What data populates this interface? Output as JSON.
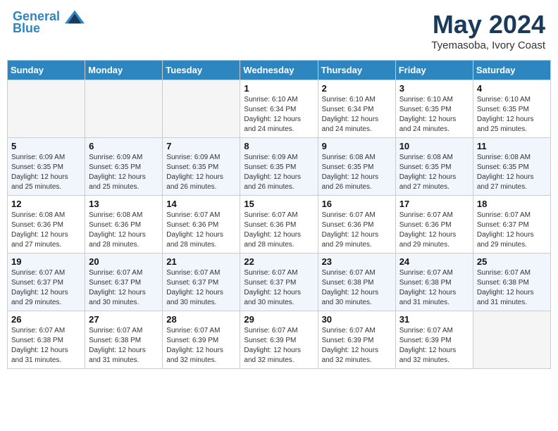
{
  "header": {
    "logo_line1": "General",
    "logo_line2": "Blue",
    "month": "May 2024",
    "location": "Tyemasoba, Ivory Coast"
  },
  "weekdays": [
    "Sunday",
    "Monday",
    "Tuesday",
    "Wednesday",
    "Thursday",
    "Friday",
    "Saturday"
  ],
  "weeks": [
    [
      {
        "day": "",
        "info": ""
      },
      {
        "day": "",
        "info": ""
      },
      {
        "day": "",
        "info": ""
      },
      {
        "day": "1",
        "info": "Sunrise: 6:10 AM\nSunset: 6:34 PM\nDaylight: 12 hours\nand 24 minutes."
      },
      {
        "day": "2",
        "info": "Sunrise: 6:10 AM\nSunset: 6:34 PM\nDaylight: 12 hours\nand 24 minutes."
      },
      {
        "day": "3",
        "info": "Sunrise: 6:10 AM\nSunset: 6:35 PM\nDaylight: 12 hours\nand 24 minutes."
      },
      {
        "day": "4",
        "info": "Sunrise: 6:10 AM\nSunset: 6:35 PM\nDaylight: 12 hours\nand 25 minutes."
      }
    ],
    [
      {
        "day": "5",
        "info": "Sunrise: 6:09 AM\nSunset: 6:35 PM\nDaylight: 12 hours\nand 25 minutes."
      },
      {
        "day": "6",
        "info": "Sunrise: 6:09 AM\nSunset: 6:35 PM\nDaylight: 12 hours\nand 25 minutes."
      },
      {
        "day": "7",
        "info": "Sunrise: 6:09 AM\nSunset: 6:35 PM\nDaylight: 12 hours\nand 26 minutes."
      },
      {
        "day": "8",
        "info": "Sunrise: 6:09 AM\nSunset: 6:35 PM\nDaylight: 12 hours\nand 26 minutes."
      },
      {
        "day": "9",
        "info": "Sunrise: 6:08 AM\nSunset: 6:35 PM\nDaylight: 12 hours\nand 26 minutes."
      },
      {
        "day": "10",
        "info": "Sunrise: 6:08 AM\nSunset: 6:35 PM\nDaylight: 12 hours\nand 27 minutes."
      },
      {
        "day": "11",
        "info": "Sunrise: 6:08 AM\nSunset: 6:35 PM\nDaylight: 12 hours\nand 27 minutes."
      }
    ],
    [
      {
        "day": "12",
        "info": "Sunrise: 6:08 AM\nSunset: 6:36 PM\nDaylight: 12 hours\nand 27 minutes."
      },
      {
        "day": "13",
        "info": "Sunrise: 6:08 AM\nSunset: 6:36 PM\nDaylight: 12 hours\nand 28 minutes."
      },
      {
        "day": "14",
        "info": "Sunrise: 6:07 AM\nSunset: 6:36 PM\nDaylight: 12 hours\nand 28 minutes."
      },
      {
        "day": "15",
        "info": "Sunrise: 6:07 AM\nSunset: 6:36 PM\nDaylight: 12 hours\nand 28 minutes."
      },
      {
        "day": "16",
        "info": "Sunrise: 6:07 AM\nSunset: 6:36 PM\nDaylight: 12 hours\nand 29 minutes."
      },
      {
        "day": "17",
        "info": "Sunrise: 6:07 AM\nSunset: 6:36 PM\nDaylight: 12 hours\nand 29 minutes."
      },
      {
        "day": "18",
        "info": "Sunrise: 6:07 AM\nSunset: 6:37 PM\nDaylight: 12 hours\nand 29 minutes."
      }
    ],
    [
      {
        "day": "19",
        "info": "Sunrise: 6:07 AM\nSunset: 6:37 PM\nDaylight: 12 hours\nand 29 minutes."
      },
      {
        "day": "20",
        "info": "Sunrise: 6:07 AM\nSunset: 6:37 PM\nDaylight: 12 hours\nand 30 minutes."
      },
      {
        "day": "21",
        "info": "Sunrise: 6:07 AM\nSunset: 6:37 PM\nDaylight: 12 hours\nand 30 minutes."
      },
      {
        "day": "22",
        "info": "Sunrise: 6:07 AM\nSunset: 6:37 PM\nDaylight: 12 hours\nand 30 minutes."
      },
      {
        "day": "23",
        "info": "Sunrise: 6:07 AM\nSunset: 6:38 PM\nDaylight: 12 hours\nand 30 minutes."
      },
      {
        "day": "24",
        "info": "Sunrise: 6:07 AM\nSunset: 6:38 PM\nDaylight: 12 hours\nand 31 minutes."
      },
      {
        "day": "25",
        "info": "Sunrise: 6:07 AM\nSunset: 6:38 PM\nDaylight: 12 hours\nand 31 minutes."
      }
    ],
    [
      {
        "day": "26",
        "info": "Sunrise: 6:07 AM\nSunset: 6:38 PM\nDaylight: 12 hours\nand 31 minutes."
      },
      {
        "day": "27",
        "info": "Sunrise: 6:07 AM\nSunset: 6:38 PM\nDaylight: 12 hours\nand 31 minutes."
      },
      {
        "day": "28",
        "info": "Sunrise: 6:07 AM\nSunset: 6:39 PM\nDaylight: 12 hours\nand 32 minutes."
      },
      {
        "day": "29",
        "info": "Sunrise: 6:07 AM\nSunset: 6:39 PM\nDaylight: 12 hours\nand 32 minutes."
      },
      {
        "day": "30",
        "info": "Sunrise: 6:07 AM\nSunset: 6:39 PM\nDaylight: 12 hours\nand 32 minutes."
      },
      {
        "day": "31",
        "info": "Sunrise: 6:07 AM\nSunset: 6:39 PM\nDaylight: 12 hours\nand 32 minutes."
      },
      {
        "day": "",
        "info": ""
      }
    ]
  ]
}
